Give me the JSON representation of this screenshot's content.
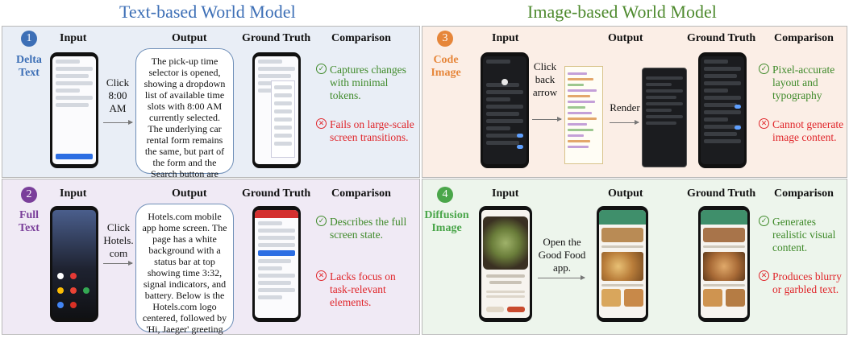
{
  "titles": {
    "text": "Text-based World Model",
    "image": "Image-based World Model"
  },
  "columns": {
    "input": "Input",
    "output": "Output",
    "ground_truth": "Ground Truth",
    "comparison": "Comparison"
  },
  "panels": {
    "delta": {
      "number": "1",
      "kind_line1": "Delta",
      "kind_line2": "Text",
      "action_line1": "Click",
      "action_line2": "8:00",
      "action_line3": "AM",
      "output": "The pick-up time selector is opened, showing a dropdown list of available time slots with 8:00 AM currently selected. The underlying car rental form remains the same, but part of the form and the Search button are covered by the dropdown overlay.",
      "pro": "Captures changes with minimal tokens.",
      "con": "Fails on large-scale screen transitions."
    },
    "full": {
      "number": "2",
      "kind_line1": "Full",
      "kind_line2": "Text",
      "action_line1": "Click",
      "action_line2": "Hotels.",
      "action_line3": "com",
      "output": "Hotels.com mobile app home screen. The page has a white background with a status bar at top showing time 3:32, signal indicators, and battery. Below is the Hotels.com logo centered, followed by 'Hi, Jaeger' greeting ……",
      "pro": "Describes the full screen state.",
      "con": "Lacks focus on task-relevant elements."
    },
    "code": {
      "number": "3",
      "kind_line1": "Code",
      "kind_line2": "Image",
      "action_line1": "Click",
      "action_line2": "back",
      "action_line3": "arrow",
      "render_label": "Render",
      "pro": "Pixel-accurate layout and typography",
      "con": "Cannot generate image content."
    },
    "diff": {
      "number": "4",
      "kind_line1": "Diffusion",
      "kind_line2": "Image",
      "action_line1": "Open the",
      "action_line2": "Good Food",
      "action_line3": "app.",
      "pro": "Generates realistic visual content.",
      "con": "Produces blurry or garbled text."
    }
  },
  "icons": {
    "pro": "check-circle-icon",
    "con": "x-circle-icon"
  },
  "colors": {
    "text_title": "#3d6fb6",
    "image_title": "#4e8a2e",
    "delta": "#3d6fb6",
    "full": "#7a3f9a",
    "code": "#e6863a",
    "diff": "#4aa64a",
    "pro": "#3f8a2a",
    "con": "#e0262b"
  }
}
